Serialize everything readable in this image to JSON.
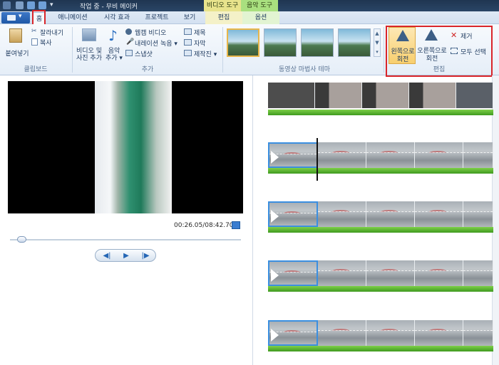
{
  "titlebar": {
    "title": "작업 중 - 무비 메이커",
    "context_tabs": [
      "비디오 도구",
      "음악 도구"
    ]
  },
  "tabs": {
    "home": "홈",
    "items": [
      "애니메이션",
      "시각 효과",
      "프로젝트",
      "보기"
    ],
    "context": [
      "편집",
      "옵션"
    ]
  },
  "ribbon": {
    "clipboard": {
      "paste": "붙여넣기",
      "cut": "잘라내기",
      "copy": "복사",
      "label": "클립보드"
    },
    "add": {
      "video_photo_line1": "비디오 및",
      "video_photo_line2": "사진 추가",
      "music_line1": "음악",
      "music_line2": "추가 ▾",
      "webcam": "웹캠 비디오",
      "narration": "내레이션 녹음 ▾",
      "snapshot": "스냅샷",
      "title": "제목",
      "caption": "자막",
      "credits": "제작진 ▾",
      "label": "추가"
    },
    "themes": {
      "label": "동영상 마법사 테마"
    },
    "edit": {
      "rotate_left_line1": "왼쪽으로",
      "rotate_left_line2": "회전",
      "rotate_right_line1": "오른쪽으로",
      "rotate_right_line2": "회전",
      "remove": "제거",
      "select_all": "모두 선택",
      "label": "편집"
    }
  },
  "player": {
    "timecode": "00:26.05/08:42.70",
    "playhead_fraction": 0.05
  }
}
